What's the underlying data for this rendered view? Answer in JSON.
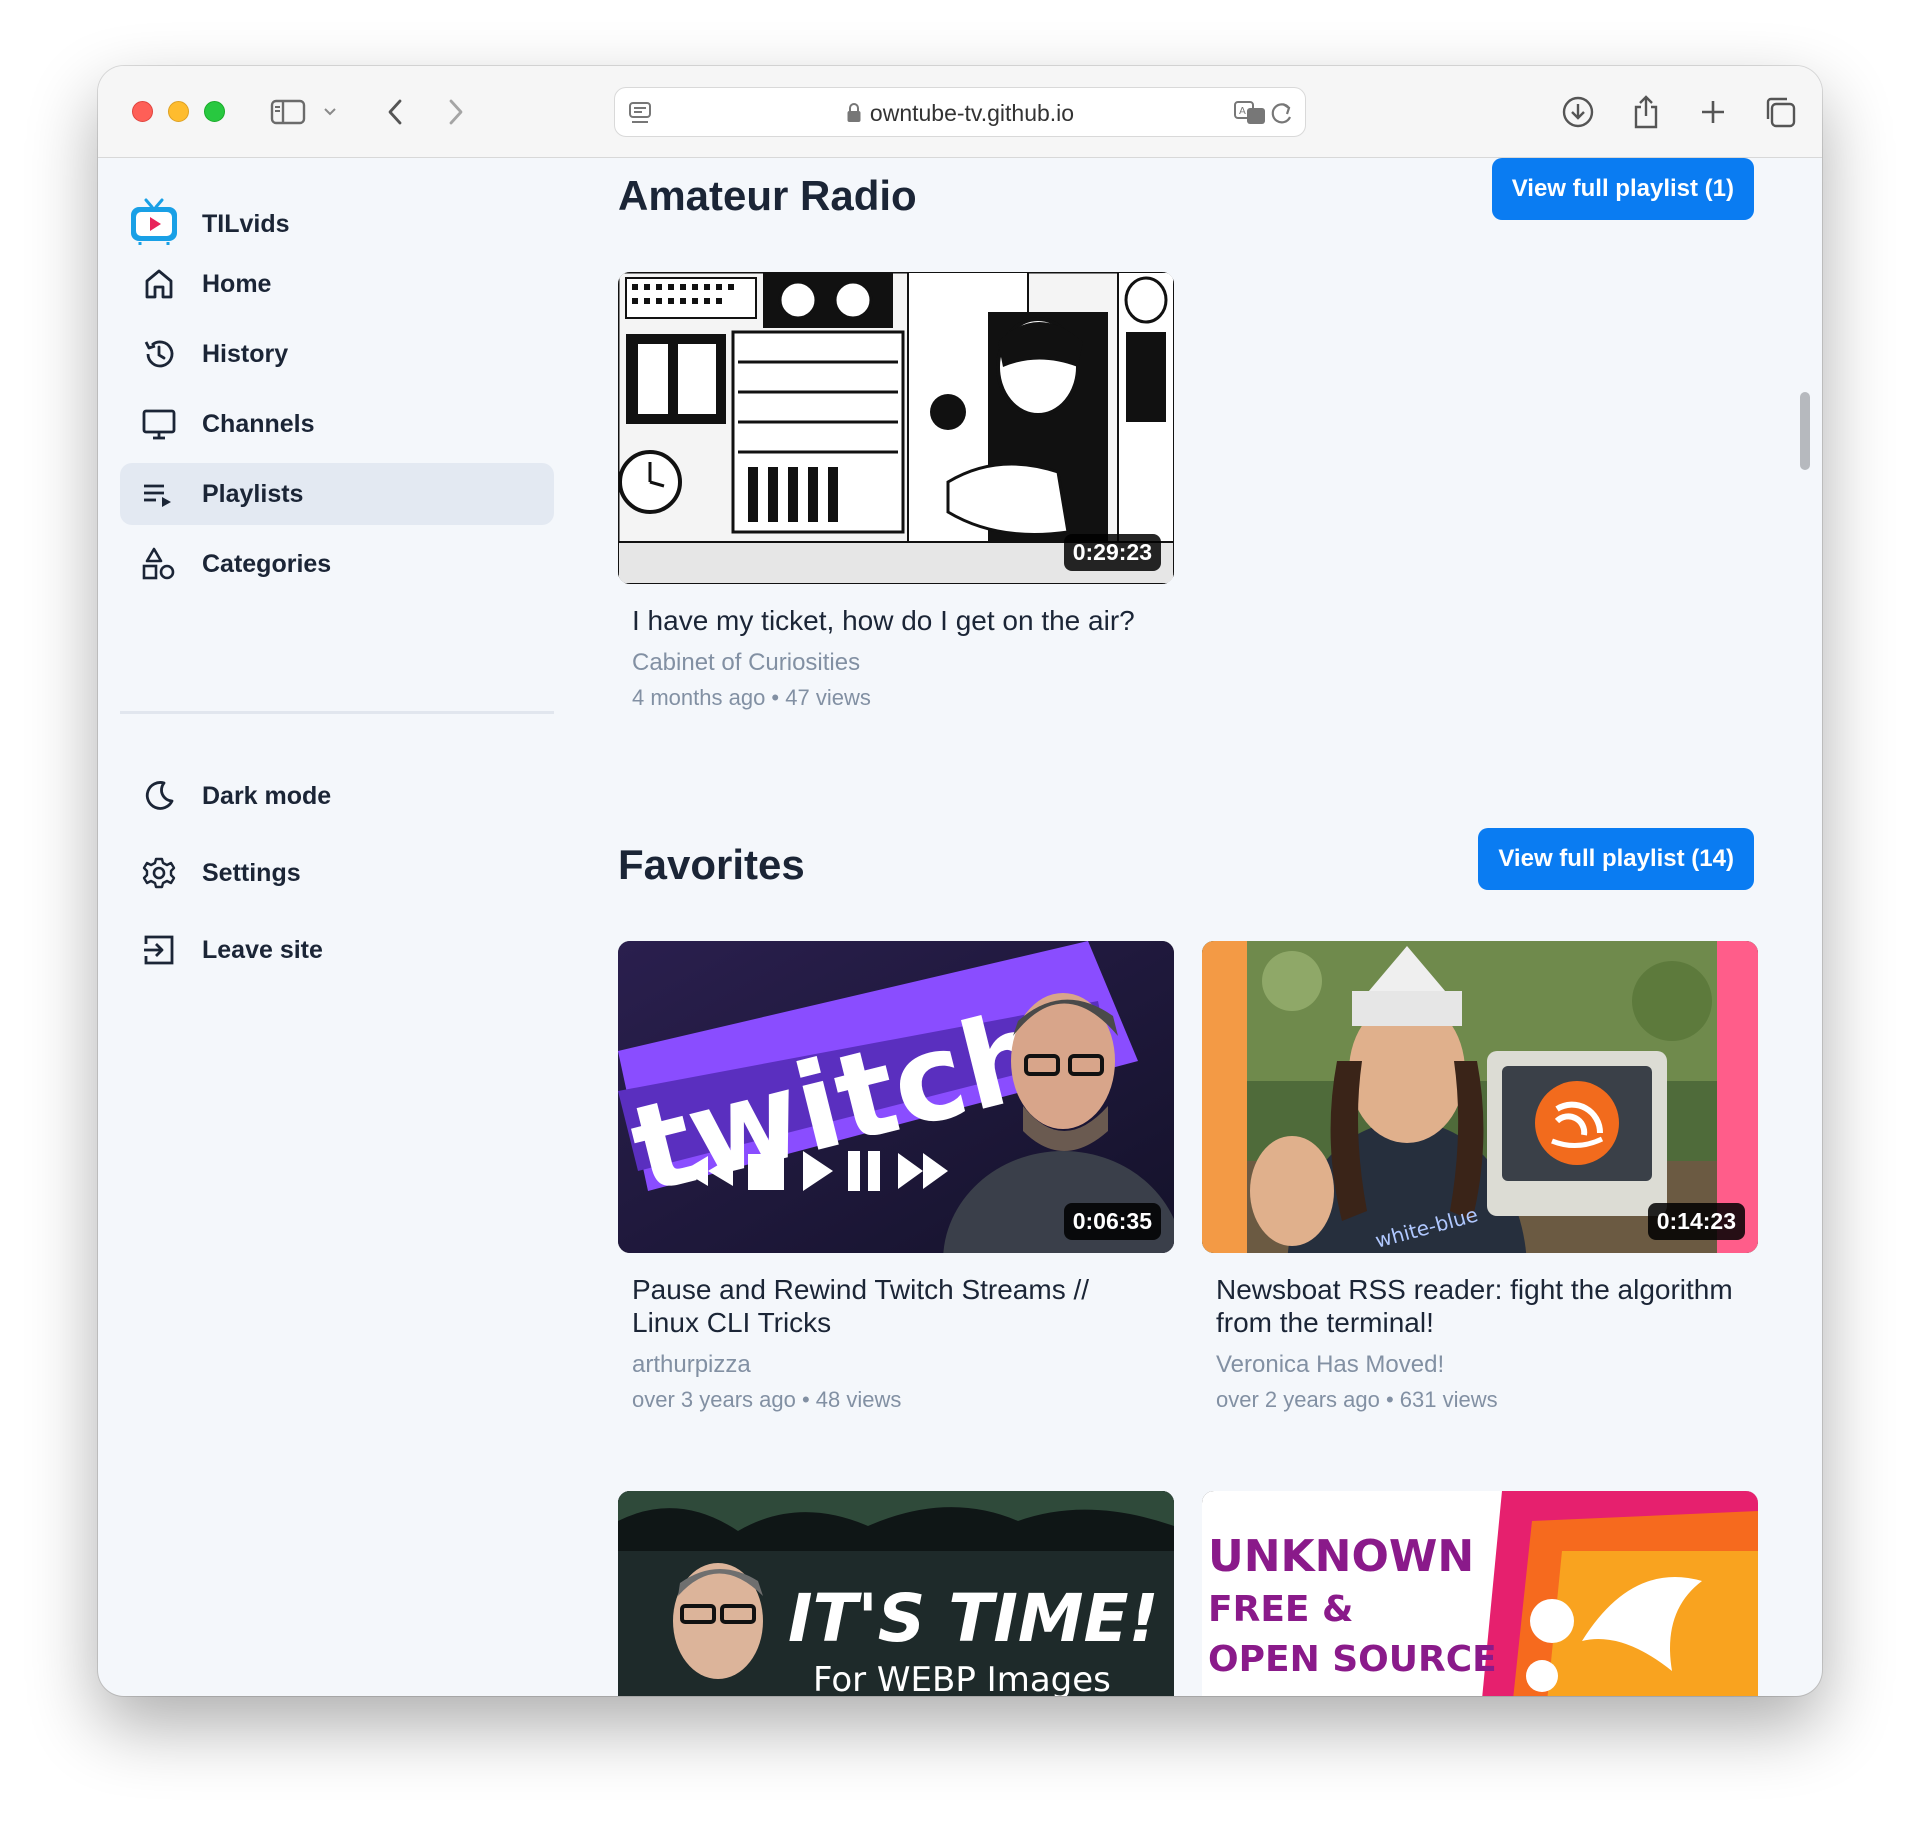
{
  "browser": {
    "url": "owntube-tv.github.io"
  },
  "app": {
    "name": "TILvids",
    "logo_icon": "tv-play-logo-icon"
  },
  "sidebar": {
    "items": [
      {
        "label": "Home",
        "icon": "home-icon",
        "active": false
      },
      {
        "label": "History",
        "icon": "history-icon",
        "active": false
      },
      {
        "label": "Channels",
        "icon": "monitor-icon",
        "active": false
      },
      {
        "label": "Playlists",
        "icon": "playlist-icon",
        "active": true
      },
      {
        "label": "Categories",
        "icon": "shapes-icon",
        "active": false
      }
    ],
    "secondary": [
      {
        "label": "Dark mode",
        "icon": "moon-icon"
      },
      {
        "label": "Settings",
        "icon": "gear-icon"
      },
      {
        "label": "Leave site",
        "icon": "exit-icon"
      }
    ]
  },
  "sections": [
    {
      "title": "Amateur Radio",
      "button": "View full playlist (1)",
      "videos": [
        {
          "title": "I have my ticket, how do I get on the air?",
          "channel": "Cabinet of Curiosities",
          "meta": "4 months ago • 47 views",
          "duration": "0:29:23"
        }
      ]
    },
    {
      "title": "Favorites",
      "button": "View full playlist (14)",
      "videos": [
        {
          "title": "Pause and Rewind Twitch Streams // Linux CLI Tricks",
          "channel": "arthurpizza",
          "meta": "over 3 years ago • 48 views",
          "duration": "0:06:35"
        },
        {
          "title": "Newsboat RSS reader: fight the algorithm from the terminal!",
          "channel": "Veronica Has Moved!",
          "meta": "over 2 years ago • 631 views",
          "duration": "0:14:23"
        },
        {
          "thumb_text": "IT'S TIME!",
          "thumb_subtext": "For WEBP Images"
        },
        {
          "thumb_text": "UNKNOWN",
          "thumb_subtext": "FREE &",
          "thumb_subtext2": "OPEN SOURCE"
        }
      ]
    }
  ],
  "thumb_text": {
    "twitch": "twitch",
    "rss_shirt": "white-blue"
  },
  "colors": {
    "accent": "#0a7cf2",
    "text": "#1b2536",
    "muted": "#8290a3",
    "active_bg": "#e3e9f2"
  }
}
